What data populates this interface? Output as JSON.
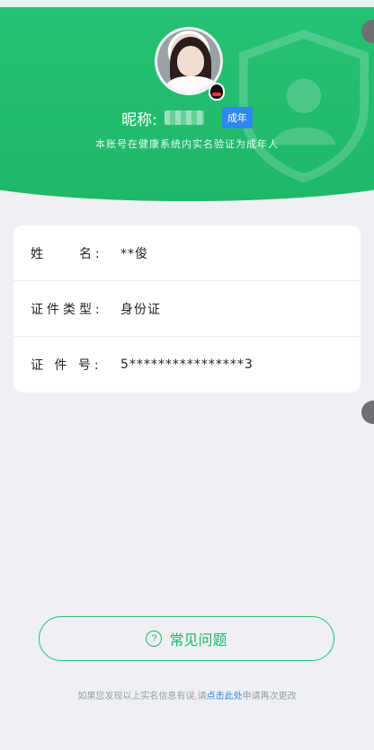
{
  "header": {
    "nickname_label": "昵称:",
    "badge": "成年",
    "verify_note": "本账号在健康系统内实名验证为成年人"
  },
  "info": {
    "rows": [
      {
        "label": "姓　　名:",
        "value": "**俊"
      },
      {
        "label": "证件类型:",
        "value": "身份证"
      },
      {
        "label": "证 件 号:",
        "value": "5****************3"
      }
    ]
  },
  "faq": {
    "icon": "?",
    "label": "常见问题"
  },
  "footer": {
    "prefix": "如果您发现以上实名信息有误,请",
    "link": "点击此处",
    "suffix": "申请再次更改"
  },
  "colors": {
    "brand_green": "#27c175",
    "badge_blue": "#2d88f0"
  }
}
